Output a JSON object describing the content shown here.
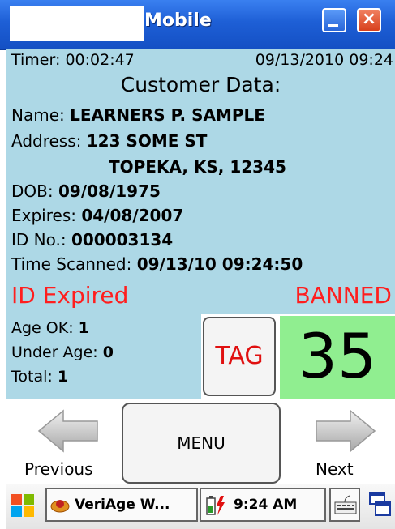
{
  "window": {
    "title": "Mobile",
    "close_label": "×"
  },
  "status": {
    "timer_label": "Timer:",
    "timer_value": "00:02:47",
    "datetime": "09/13/2010 09:24"
  },
  "customer": {
    "heading": "Customer Data:",
    "name_label": "Name:",
    "name": "LEARNERS P. SAMPLE",
    "address_label": "Address:",
    "address_line1": "123 SOME ST",
    "address_line2": "TOPEKA, KS, 12345",
    "dob_label": "DOB:",
    "dob": "09/08/1975",
    "expires_label": "Expires:",
    "expires": "04/08/2007",
    "id_label": "ID No.:",
    "id_no": "000003134",
    "scanned_label": "Time Scanned:",
    "scanned": "09/13/10 09:24:50"
  },
  "alerts": {
    "expired": "ID Expired",
    "banned": "BANNED",
    "color": "#ff1e1e"
  },
  "counts": {
    "age_ok_label": "Age OK:",
    "age_ok": "1",
    "under_age_label": "Under Age:",
    "under_age": "0",
    "total_label": "Total:",
    "total": "1",
    "big_count": "35",
    "big_count_bg": "#90ee90"
  },
  "buttons": {
    "tag": "TAG",
    "menu": "MENU",
    "previous": "Previous",
    "next": "Next"
  },
  "taskbar": {
    "app_label": "VeriAge W...",
    "time": "9:24 AM",
    "icons": [
      "windows-start-icon",
      "veriage-app-icon",
      "battery-icon",
      "keyboard-icon",
      "switch-windows-icon"
    ]
  },
  "colors": {
    "content_bg": "#add8e6",
    "titlebar": "#1e5fd6"
  }
}
